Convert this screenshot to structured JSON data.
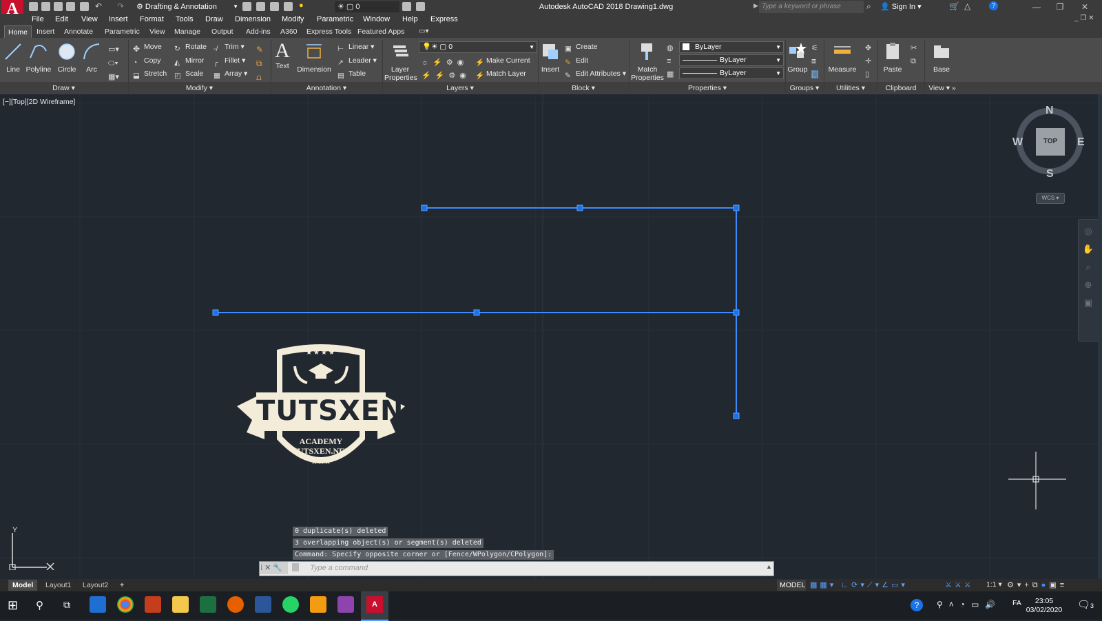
{
  "app": {
    "title": "Autodesk AutoCAD 2018    Drawing1.dwg",
    "logo_letter": "A",
    "workspace": "Drafting & Annotation",
    "qa_layer": "0",
    "search_placeholder": "Type a keyword or phrase",
    "sign_in": "Sign In"
  },
  "menu": [
    "File",
    "Edit",
    "View",
    "Insert",
    "Format",
    "Tools",
    "Draw",
    "Dimension",
    "Modify",
    "Parametric",
    "Window",
    "Help",
    "Express"
  ],
  "tabs": [
    "Home",
    "Insert",
    "Annotate",
    "Parametric",
    "View",
    "Manage",
    "Output",
    "Add-ins",
    "A360",
    "Express Tools",
    "Featured Apps"
  ],
  "active_tab": "Home",
  "ribbon": {
    "draw": {
      "line": "Line",
      "polyline": "Polyline",
      "circle": "Circle",
      "arc": "Arc",
      "label": "Draw"
    },
    "modify": {
      "move": "Move",
      "copy": "Copy",
      "stretch": "Stretch",
      "rotate": "Rotate",
      "mirror": "Mirror",
      "scale": "Scale",
      "trim": "Trim",
      "fillet": "Fillet",
      "array": "Array",
      "label": "Modify"
    },
    "annotation": {
      "text": "Text",
      "dimension": "Dimension",
      "linear": "Linear",
      "leader": "Leader",
      "table": "Table",
      "label": "Annotation"
    },
    "layers": {
      "properties": "Layer Properties",
      "current_layer": "0",
      "make_current": "Make Current",
      "match_layer": "Match Layer",
      "label": "Layers"
    },
    "block": {
      "insert": "Insert",
      "create": "Create",
      "edit": "Edit",
      "edit_attributes": "Edit Attributes",
      "label": "Block"
    },
    "properties": {
      "match": "Match Properties",
      "color": "ByLayer",
      "linetype": "ByLayer",
      "lineweight": "ByLayer",
      "label": "Properties"
    },
    "groups": {
      "group": "Group",
      "label": "Groups"
    },
    "utilities": {
      "measure": "Measure",
      "label": "Utilities"
    },
    "clipboard": {
      "paste": "Paste",
      "label": "Clipboard"
    },
    "view": {
      "base": "Base",
      "label": "View"
    }
  },
  "viewport": {
    "label": "[−][Top][2D Wireframe]",
    "viewcube": {
      "n": "N",
      "s": "S",
      "e": "E",
      "w": "W",
      "face": "TOP",
      "wcs": "WCS"
    },
    "ucs": {
      "y": "Y"
    }
  },
  "logo": {
    "brand": "TUTSXEN",
    "line1": "ACADEMY",
    "line2": "TUTSXEN.NET"
  },
  "command": {
    "history": [
      "0 duplicate(s) deleted",
      "3 overlapping object(s) or segment(s) deleted",
      "Command: Specify opposite corner or [Fence/WPolygon/CPolygon]:"
    ],
    "placeholder": "Type a command"
  },
  "layout_tabs": [
    "Model",
    "Layout1",
    "Layout2"
  ],
  "status": {
    "model": "MODEL",
    "scale": "1:1"
  },
  "taskbar": {
    "lang": "FA",
    "time": "23:05",
    "date": "03/02/2020",
    "notif": "3"
  },
  "colors": {
    "selection": "#3d8bff",
    "grip": "#1a73e8",
    "background": "#212830",
    "ribbon": "#4c4c4c"
  }
}
